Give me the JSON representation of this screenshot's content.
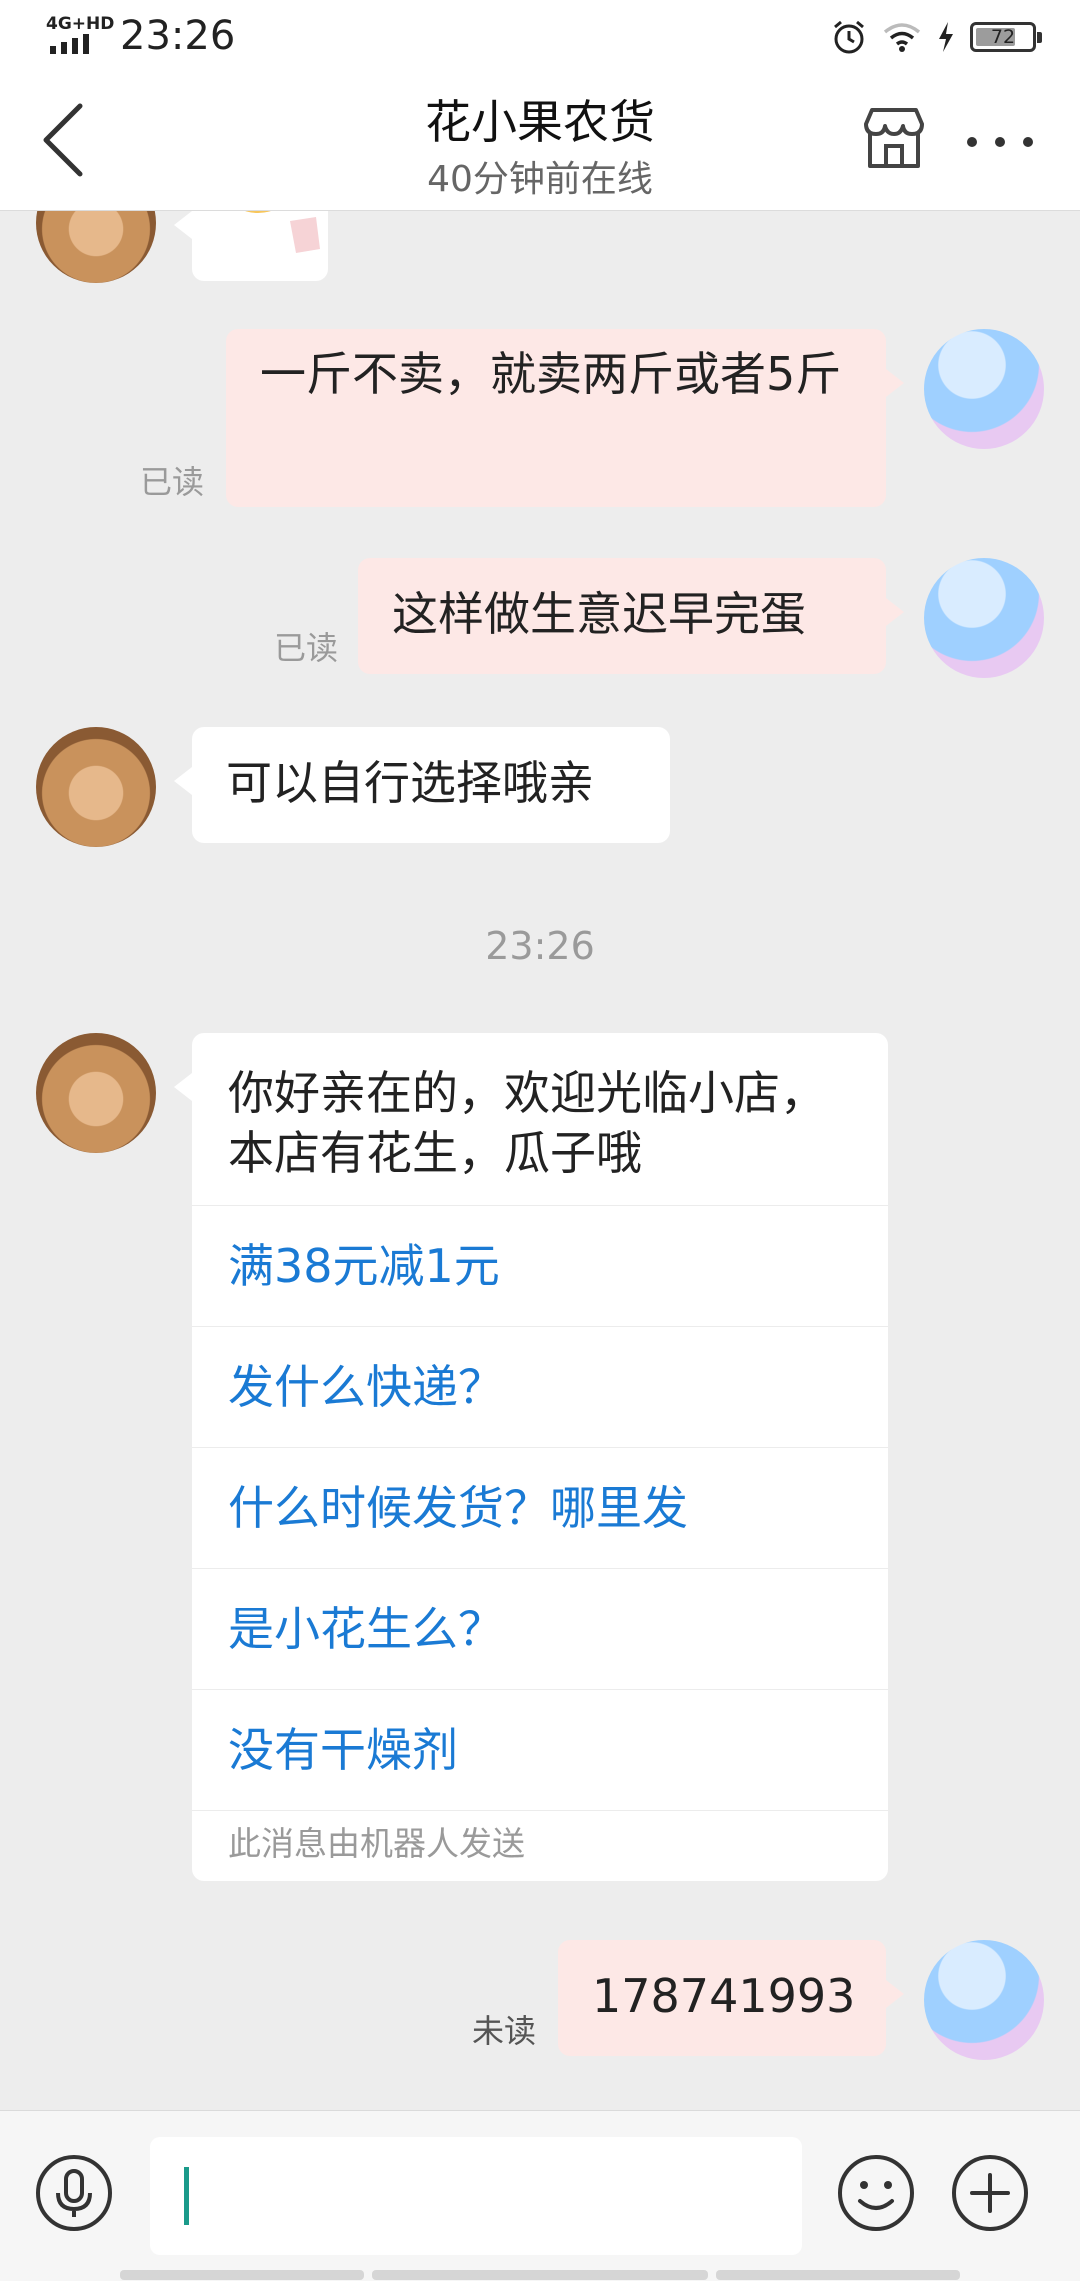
{
  "status_bar": {
    "network": "4G+HD",
    "time": "23:26",
    "battery": "72",
    "battery_level": 0.72
  },
  "header": {
    "title": "花小果农货",
    "subtitle": "40分钟前在线"
  },
  "messages": [
    {
      "type": "incoming_sticker"
    },
    {
      "type": "outgoing",
      "text": "一斤不卖，就卖两斤或者5斤",
      "status": "已读"
    },
    {
      "type": "outgoing",
      "text": "这样做生意迟早完蛋",
      "status": "已读"
    },
    {
      "type": "incoming",
      "text": "可以自行选择哦亲"
    },
    {
      "type": "timestamp",
      "text": "23:26"
    },
    {
      "type": "incoming_bot",
      "text": "你好亲在的，欢迎光临小店，本店有花生，瓜子哦",
      "options": [
        "满38元减1元",
        "发什么快递？",
        "什么时候发货？哪里发",
        "是小花生么？",
        "没有干燥剂"
      ],
      "footer": "此消息由机器人发送"
    },
    {
      "type": "outgoing",
      "text": "178741993",
      "status": "未读"
    }
  ],
  "input": {
    "value": ""
  },
  "colors": {
    "background": "#ededed",
    "outgoing_bubble": "#fde8e6",
    "incoming_bubble": "#ffffff",
    "link": "#1a7ad4",
    "caret": "#1a9a8a"
  }
}
